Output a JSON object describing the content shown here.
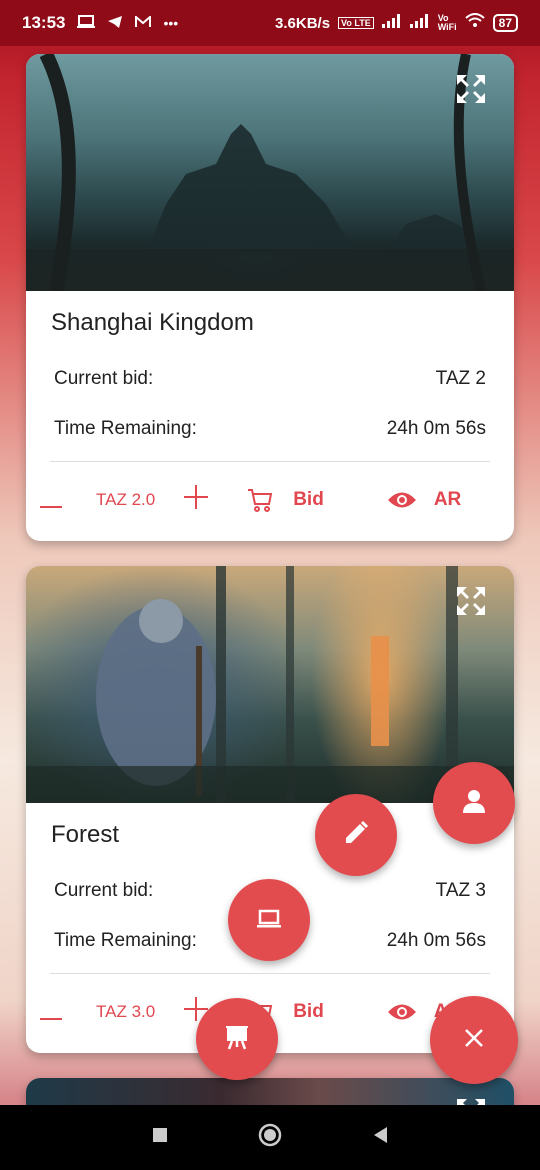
{
  "status_bar": {
    "time": "13:53",
    "left_icons": [
      "laptop-icon",
      "telegram-icon",
      "gmail-icon",
      "more-icon"
    ],
    "speed": "3.6KB/s",
    "battery": "87"
  },
  "cards": [
    {
      "title": "Shanghai Kingdom",
      "current_bid_label": "Current bid:",
      "current_bid_value": "TAZ 2",
      "time_label": "Time Remaining:",
      "time_value": "24h 0m 56s",
      "bid_amount": "TAZ 2.0",
      "bid_label": "Bid",
      "ar_label": "AR"
    },
    {
      "title": "Forest",
      "current_bid_label": "Current bid:",
      "current_bid_value": "TAZ 3",
      "time_label": "Time Remaining:",
      "time_value": "24h 0m 56s",
      "bid_amount": "TAZ 3.0",
      "bid_label": "Bid",
      "ar_label": "AR"
    }
  ],
  "fabs": [
    "profile-icon",
    "edit-icon",
    "laptop-icon",
    "easel-icon",
    "close-icon"
  ],
  "colors": {
    "accent": "#e24c4f",
    "status_bar": "#8e0b17"
  }
}
